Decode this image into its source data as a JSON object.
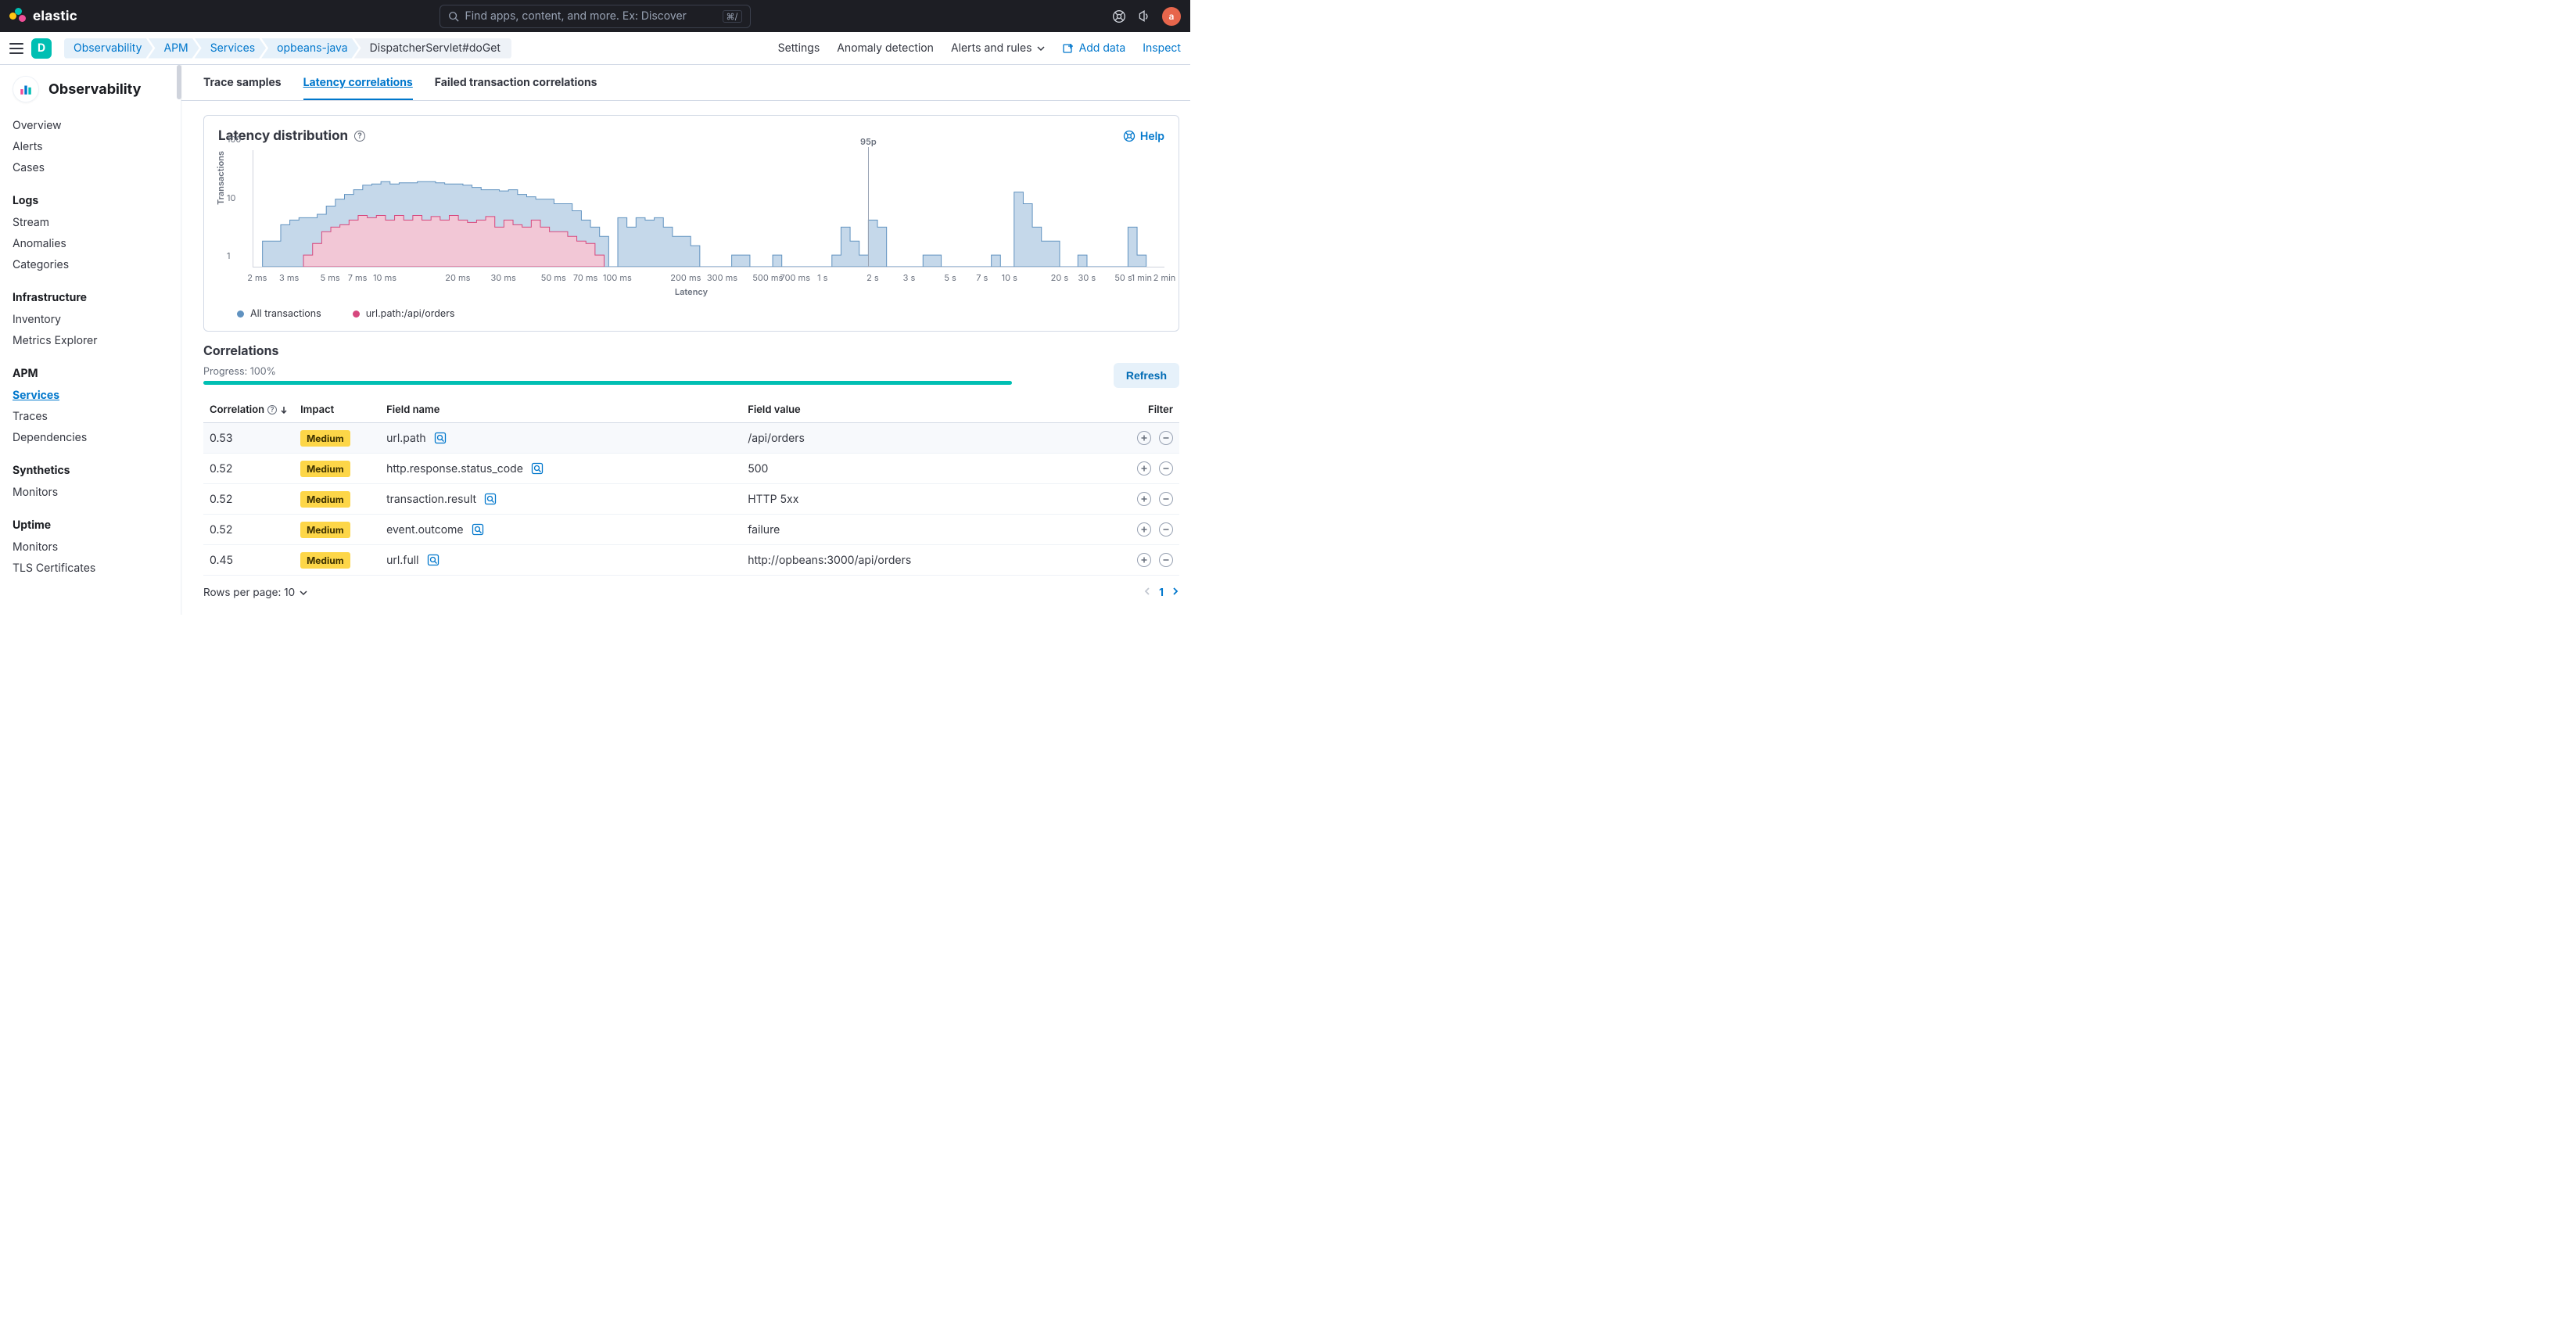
{
  "header": {
    "brand": "elastic",
    "search_placeholder": "Find apps, content, and more. Ex: Discover",
    "search_shortcut": "⌘/",
    "avatar_initial": "a"
  },
  "subheader": {
    "space_initial": "D",
    "breadcrumbs": [
      "Observability",
      "APM",
      "Services",
      "opbeans-java",
      "DispatcherServlet#doGet"
    ],
    "right": {
      "settings": "Settings",
      "anomaly": "Anomaly detection",
      "alerts": "Alerts and rules",
      "add_data": "Add data",
      "inspect": "Inspect"
    }
  },
  "sidebar": {
    "title": "Observability",
    "top_items": [
      "Overview",
      "Alerts",
      "Cases"
    ],
    "groups": [
      {
        "title": "Logs",
        "items": [
          "Stream",
          "Anomalies",
          "Categories"
        ]
      },
      {
        "title": "Infrastructure",
        "items": [
          "Inventory",
          "Metrics Explorer"
        ]
      },
      {
        "title": "APM",
        "items": [
          "Services",
          "Traces",
          "Dependencies"
        ],
        "active": "Services"
      },
      {
        "title": "Synthetics",
        "items": [
          "Monitors"
        ]
      },
      {
        "title": "Uptime",
        "items": [
          "Monitors",
          "TLS Certificates"
        ]
      }
    ]
  },
  "tabs": {
    "items": [
      "Trace samples",
      "Latency correlations",
      "Failed transaction correlations"
    ],
    "active": "Latency correlations"
  },
  "panel": {
    "title": "Latency distribution",
    "help": "Help"
  },
  "chart_data": {
    "type": "bar",
    "ylabel": "Transactions",
    "xlabel": "Latency",
    "yticks": [
      1,
      10,
      100
    ],
    "ylim_log": [
      1,
      100
    ],
    "p95_label": "95p",
    "p95_x_frac": 0.675,
    "xticks": [
      {
        "label": "2 ms",
        "frac": 0.005
      },
      {
        "label": "3 ms",
        "frac": 0.04
      },
      {
        "label": "5 ms",
        "frac": 0.085
      },
      {
        "label": "7 ms",
        "frac": 0.115
      },
      {
        "label": "10 ms",
        "frac": 0.145
      },
      {
        "label": "20 ms",
        "frac": 0.225
      },
      {
        "label": "30 ms",
        "frac": 0.275
      },
      {
        "label": "50 ms",
        "frac": 0.33
      },
      {
        "label": "70 ms",
        "frac": 0.365
      },
      {
        "label": "100 ms",
        "frac": 0.4
      },
      {
        "label": "200 ms",
        "frac": 0.475
      },
      {
        "label": "300 ms",
        "frac": 0.515
      },
      {
        "label": "500 ms",
        "frac": 0.565
      },
      {
        "label": "700 ms",
        "frac": 0.595
      },
      {
        "label": "1 s",
        "frac": 0.625
      },
      {
        "label": "2 s",
        "frac": 0.68
      },
      {
        "label": "3 s",
        "frac": 0.72
      },
      {
        "label": "5 s",
        "frac": 0.765
      },
      {
        "label": "7 s",
        "frac": 0.8
      },
      {
        "label": "10 s",
        "frac": 0.83
      },
      {
        "label": "20 s",
        "frac": 0.885
      },
      {
        "label": "30 s",
        "frac": 0.915
      },
      {
        "label": "50 s",
        "frac": 0.955
      },
      {
        "label": "1 min",
        "frac": 0.975
      },
      {
        "label": "2 min",
        "frac": 1.0
      }
    ],
    "series": [
      {
        "name": "All transactions",
        "color_fill": "#c5d8ea",
        "color_stroke": "#6092c0",
        "bins": [
          {
            "x": 0.01,
            "h": 0.22
          },
          {
            "x": 0.02,
            "h": 0.22
          },
          {
            "x": 0.03,
            "h": 0.36
          },
          {
            "x": 0.04,
            "h": 0.4
          },
          {
            "x": 0.05,
            "h": 0.42
          },
          {
            "x": 0.06,
            "h": 0.42
          },
          {
            "x": 0.07,
            "h": 0.45
          },
          {
            "x": 0.08,
            "h": 0.52
          },
          {
            "x": 0.09,
            "h": 0.58
          },
          {
            "x": 0.1,
            "h": 0.62
          },
          {
            "x": 0.11,
            "h": 0.66
          },
          {
            "x": 0.12,
            "h": 0.7
          },
          {
            "x": 0.13,
            "h": 0.71
          },
          {
            "x": 0.14,
            "h": 0.73
          },
          {
            "x": 0.15,
            "h": 0.71
          },
          {
            "x": 0.16,
            "h": 0.72
          },
          {
            "x": 0.17,
            "h": 0.72
          },
          {
            "x": 0.18,
            "h": 0.73
          },
          {
            "x": 0.19,
            "h": 0.73
          },
          {
            "x": 0.2,
            "h": 0.72
          },
          {
            "x": 0.21,
            "h": 0.71
          },
          {
            "x": 0.22,
            "h": 0.71
          },
          {
            "x": 0.23,
            "h": 0.7
          },
          {
            "x": 0.24,
            "h": 0.68
          },
          {
            "x": 0.25,
            "h": 0.66
          },
          {
            "x": 0.26,
            "h": 0.66
          },
          {
            "x": 0.27,
            "h": 0.65
          },
          {
            "x": 0.28,
            "h": 0.66
          },
          {
            "x": 0.29,
            "h": 0.62
          },
          {
            "x": 0.3,
            "h": 0.6
          },
          {
            "x": 0.31,
            "h": 0.58
          },
          {
            "x": 0.32,
            "h": 0.58
          },
          {
            "x": 0.33,
            "h": 0.54
          },
          {
            "x": 0.34,
            "h": 0.54
          },
          {
            "x": 0.35,
            "h": 0.48
          },
          {
            "x": 0.36,
            "h": 0.4
          },
          {
            "x": 0.37,
            "h": 0.34
          },
          {
            "x": 0.38,
            "h": 0.26
          },
          {
            "x": 0.4,
            "h": 0.42
          },
          {
            "x": 0.41,
            "h": 0.34
          },
          {
            "x": 0.42,
            "h": 0.42
          },
          {
            "x": 0.43,
            "h": 0.4
          },
          {
            "x": 0.44,
            "h": 0.42
          },
          {
            "x": 0.45,
            "h": 0.34
          },
          {
            "x": 0.46,
            "h": 0.26
          },
          {
            "x": 0.47,
            "h": 0.26
          },
          {
            "x": 0.48,
            "h": 0.18
          },
          {
            "x": 0.525,
            "h": 0.1
          },
          {
            "x": 0.535,
            "h": 0.1
          },
          {
            "x": 0.57,
            "h": 0.1
          },
          {
            "x": 0.635,
            "h": 0.1
          },
          {
            "x": 0.645,
            "h": 0.34
          },
          {
            "x": 0.655,
            "h": 0.22
          },
          {
            "x": 0.665,
            "h": 0.1
          },
          {
            "x": 0.675,
            "h": 0.4
          },
          {
            "x": 0.685,
            "h": 0.34
          },
          {
            "x": 0.735,
            "h": 0.1
          },
          {
            "x": 0.745,
            "h": 0.1
          },
          {
            "x": 0.81,
            "h": 0.1
          },
          {
            "x": 0.835,
            "h": 0.64
          },
          {
            "x": 0.845,
            "h": 0.54
          },
          {
            "x": 0.855,
            "h": 0.34
          },
          {
            "x": 0.865,
            "h": 0.22
          },
          {
            "x": 0.875,
            "h": 0.22
          },
          {
            "x": 0.905,
            "h": 0.1
          },
          {
            "x": 0.96,
            "h": 0.34
          },
          {
            "x": 0.97,
            "h": 0.1
          }
        ]
      },
      {
        "name": "url.path:/api/orders",
        "color_fill": "#f2c7d6",
        "color_stroke": "#d6487e",
        "bins": [
          {
            "x": 0.055,
            "h": 0.1
          },
          {
            "x": 0.065,
            "h": 0.2
          },
          {
            "x": 0.075,
            "h": 0.3
          },
          {
            "x": 0.085,
            "h": 0.34
          },
          {
            "x": 0.095,
            "h": 0.36
          },
          {
            "x": 0.105,
            "h": 0.4
          },
          {
            "x": 0.115,
            "h": 0.44
          },
          {
            "x": 0.125,
            "h": 0.42
          },
          {
            "x": 0.135,
            "h": 0.44
          },
          {
            "x": 0.145,
            "h": 0.4
          },
          {
            "x": 0.155,
            "h": 0.44
          },
          {
            "x": 0.165,
            "h": 0.4
          },
          {
            "x": 0.175,
            "h": 0.44
          },
          {
            "x": 0.185,
            "h": 0.4
          },
          {
            "x": 0.195,
            "h": 0.43
          },
          {
            "x": 0.205,
            "h": 0.4
          },
          {
            "x": 0.215,
            "h": 0.44
          },
          {
            "x": 0.225,
            "h": 0.4
          },
          {
            "x": 0.235,
            "h": 0.38
          },
          {
            "x": 0.245,
            "h": 0.4
          },
          {
            "x": 0.255,
            "h": 0.43
          },
          {
            "x": 0.265,
            "h": 0.34
          },
          {
            "x": 0.275,
            "h": 0.4
          },
          {
            "x": 0.285,
            "h": 0.36
          },
          {
            "x": 0.295,
            "h": 0.34
          },
          {
            "x": 0.305,
            "h": 0.4
          },
          {
            "x": 0.315,
            "h": 0.34
          },
          {
            "x": 0.325,
            "h": 0.3
          },
          {
            "x": 0.335,
            "h": 0.3
          },
          {
            "x": 0.345,
            "h": 0.26
          },
          {
            "x": 0.355,
            "h": 0.22
          },
          {
            "x": 0.365,
            "h": 0.2
          },
          {
            "x": 0.375,
            "h": 0.1
          }
        ]
      }
    ],
    "legend": [
      {
        "label": "All transactions",
        "color": "#6092c0"
      },
      {
        "label": "url.path:/api/orders",
        "color": "#d6487e"
      }
    ]
  },
  "correlations": {
    "title": "Correlations",
    "progress_label": "Progress: 100%",
    "refresh": "Refresh",
    "columns": {
      "correlation": "Correlation",
      "impact": "Impact",
      "field_name": "Field name",
      "field_value": "Field value",
      "filter": "Filter"
    },
    "rows": [
      {
        "correlation": "0.53",
        "impact": "Medium",
        "field_name": "url.path",
        "field_value": "/api/orders"
      },
      {
        "correlation": "0.52",
        "impact": "Medium",
        "field_name": "http.response.status_code",
        "field_value": "500"
      },
      {
        "correlation": "0.52",
        "impact": "Medium",
        "field_name": "transaction.result",
        "field_value": "HTTP 5xx"
      },
      {
        "correlation": "0.52",
        "impact": "Medium",
        "field_name": "event.outcome",
        "field_value": "failure"
      },
      {
        "correlation": "0.45",
        "impact": "Medium",
        "field_name": "url.full",
        "field_value": "http://opbeans:3000/api/orders"
      }
    ],
    "rows_per_page_label": "Rows per page: 10",
    "page": "1"
  }
}
